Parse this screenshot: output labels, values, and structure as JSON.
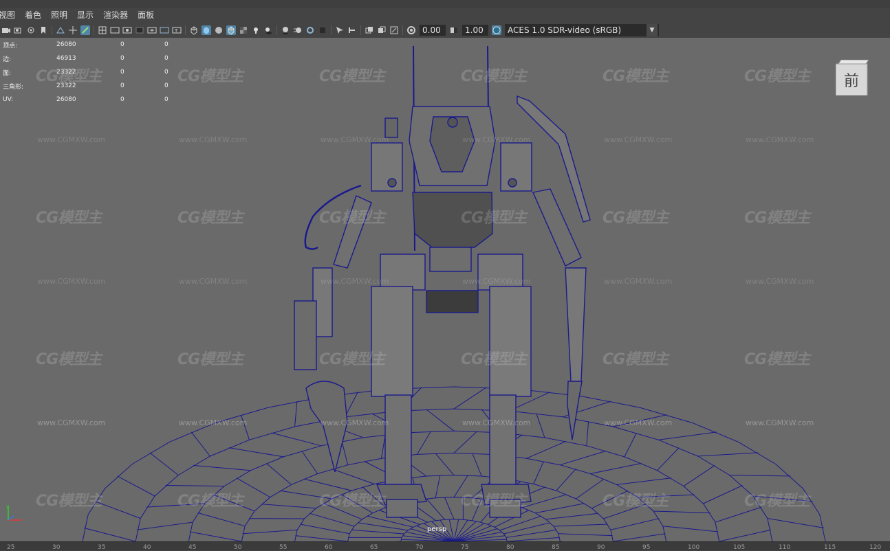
{
  "menu": [
    "视图",
    "着色",
    "照明",
    "显示",
    "渲染器",
    "面板"
  ],
  "toolbar": {
    "exposure_value": "0.00",
    "gamma_value": "1.00",
    "color_space": "ACES 1.0 SDR-video (sRGB)",
    "icons": [
      "camera-icon",
      "camera-attributes-icon",
      "bookmark-icon",
      "image-plane-icon",
      "2d-pan-icon",
      "grease-pencil-icon",
      "grid-icon",
      "film-gate-icon",
      "resolution-gate-icon",
      "gate-mask-icon",
      "field-chart-icon",
      "safe-action-icon",
      "safe-title-icon",
      "wireframe-icon",
      "smooth-shade-icon",
      "default-material-icon",
      "wireframe-on-shaded-icon",
      "xray-icon",
      "use-lights-icon",
      "shadows-icon",
      "screen-space-ao-icon",
      "motion-blur-icon",
      "multisample-aa-icon",
      "depth-of-field-icon",
      "isolate-select-icon",
      "xray-joints-icon",
      "xray-active-icon",
      "exposure-icon",
      "gamma-icon",
      "color-management-icon"
    ]
  },
  "stats": [
    {
      "label": "顶点:",
      "v1": "26080",
      "v2": "0",
      "v3": "0"
    },
    {
      "label": "边:",
      "v1": "46913",
      "v2": "0",
      "v3": "0"
    },
    {
      "label": "面:",
      "v1": "23322",
      "v2": "0",
      "v3": "0"
    },
    {
      "label": "三角形:",
      "v1": "23322",
      "v2": "0",
      "v3": "0"
    },
    {
      "label": "UV:",
      "v1": "26080",
      "v2": "0",
      "v3": "0"
    }
  ],
  "viewcube_label": "前",
  "camera_label": "persp",
  "watermark": {
    "logo": "CG模型主",
    "url": "www.CGMXW.com"
  },
  "timeline_ticks": [
    "25",
    "30",
    "35",
    "40",
    "45",
    "50",
    "55",
    "60",
    "65",
    "70",
    "75",
    "80",
    "85",
    "90",
    "95",
    "100",
    "105",
    "110",
    "115",
    "120"
  ],
  "colors": {
    "viewport_bg": "#6a6a6a",
    "wireframe": "#1a1a8c",
    "accent": "#5285a6"
  }
}
